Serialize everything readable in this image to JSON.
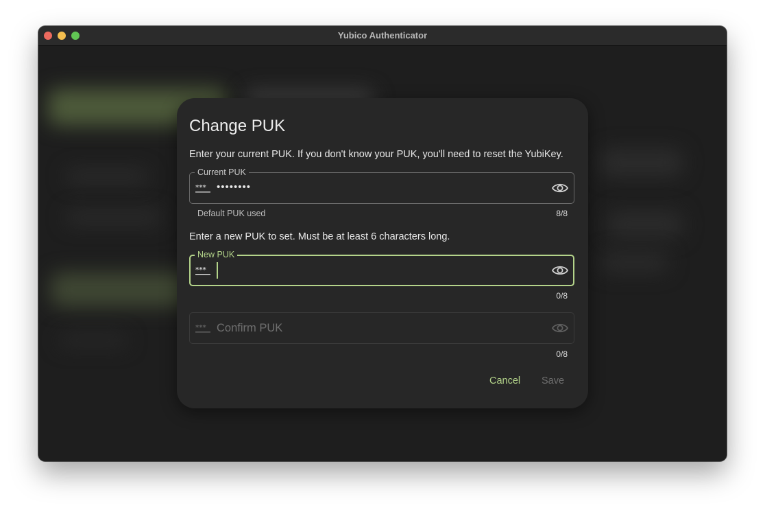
{
  "window": {
    "title": "Yubico Authenticator"
  },
  "dialog": {
    "title": "Change PUK",
    "current_instructions": "Enter your current PUK. If you don't know your PUK, you'll need to reset the YubiKey.",
    "new_instructions": "Enter a new PUK to set. Must be at least 6 characters long.",
    "current_puk": {
      "label": "Current PUK",
      "value": "••••••••",
      "helper": "Default PUK used",
      "counter": "8/8"
    },
    "new_puk": {
      "label": "New PUK",
      "value": "",
      "counter": "0/8"
    },
    "confirm_puk": {
      "placeholder": "Confirm PUK",
      "counter": "0/8"
    },
    "cancel_label": "Cancel",
    "save_label": "Save"
  },
  "icons": {
    "password": "password-icon",
    "visibility": "eye-icon"
  },
  "colors": {
    "accent": "#b4d48a",
    "dialog_bg": "#272727",
    "disabled_text": "#6e6e6e"
  }
}
